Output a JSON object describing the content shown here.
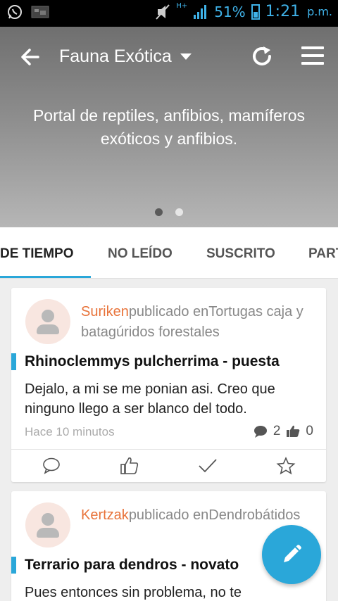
{
  "status_bar": {
    "battery": "51%",
    "time": "1:21",
    "ampm": "p.m.",
    "network": "H+"
  },
  "header": {
    "title": "Fauna Exótica",
    "description": "Portal de reptiles, anfibios, mamíferos exóticos y anfibios.",
    "back_icon": "arrow-left-icon",
    "refresh_icon": "refresh-icon",
    "menu_icon": "hamburger-menu-icon"
  },
  "tabs": [
    "DE TIEMPO",
    "NO LEÍDO",
    "SUSCRITO",
    "PART"
  ],
  "posts": [
    {
      "author": "Suriken",
      "published": "publicado en",
      "forum": "Tortugas caja y batagúridos forestales",
      "title": "Rhinoclemmys pulcherrima - puesta",
      "excerpt": "Dejalo, a mi se me ponian asi. Creo que ninguno llego a ser blanco del todo.",
      "time": "Hace 10 minutos",
      "comments": "2",
      "likes": "0"
    },
    {
      "author": "Kertzak",
      "published": "publicado en",
      "forum": "Dendrobátidos",
      "title": "Terrario para dendros - novato",
      "excerpt": "Pues entonces sin problema, no te"
    }
  ],
  "colors": {
    "accent": "#2aa7d9",
    "author": "#e8733a"
  }
}
